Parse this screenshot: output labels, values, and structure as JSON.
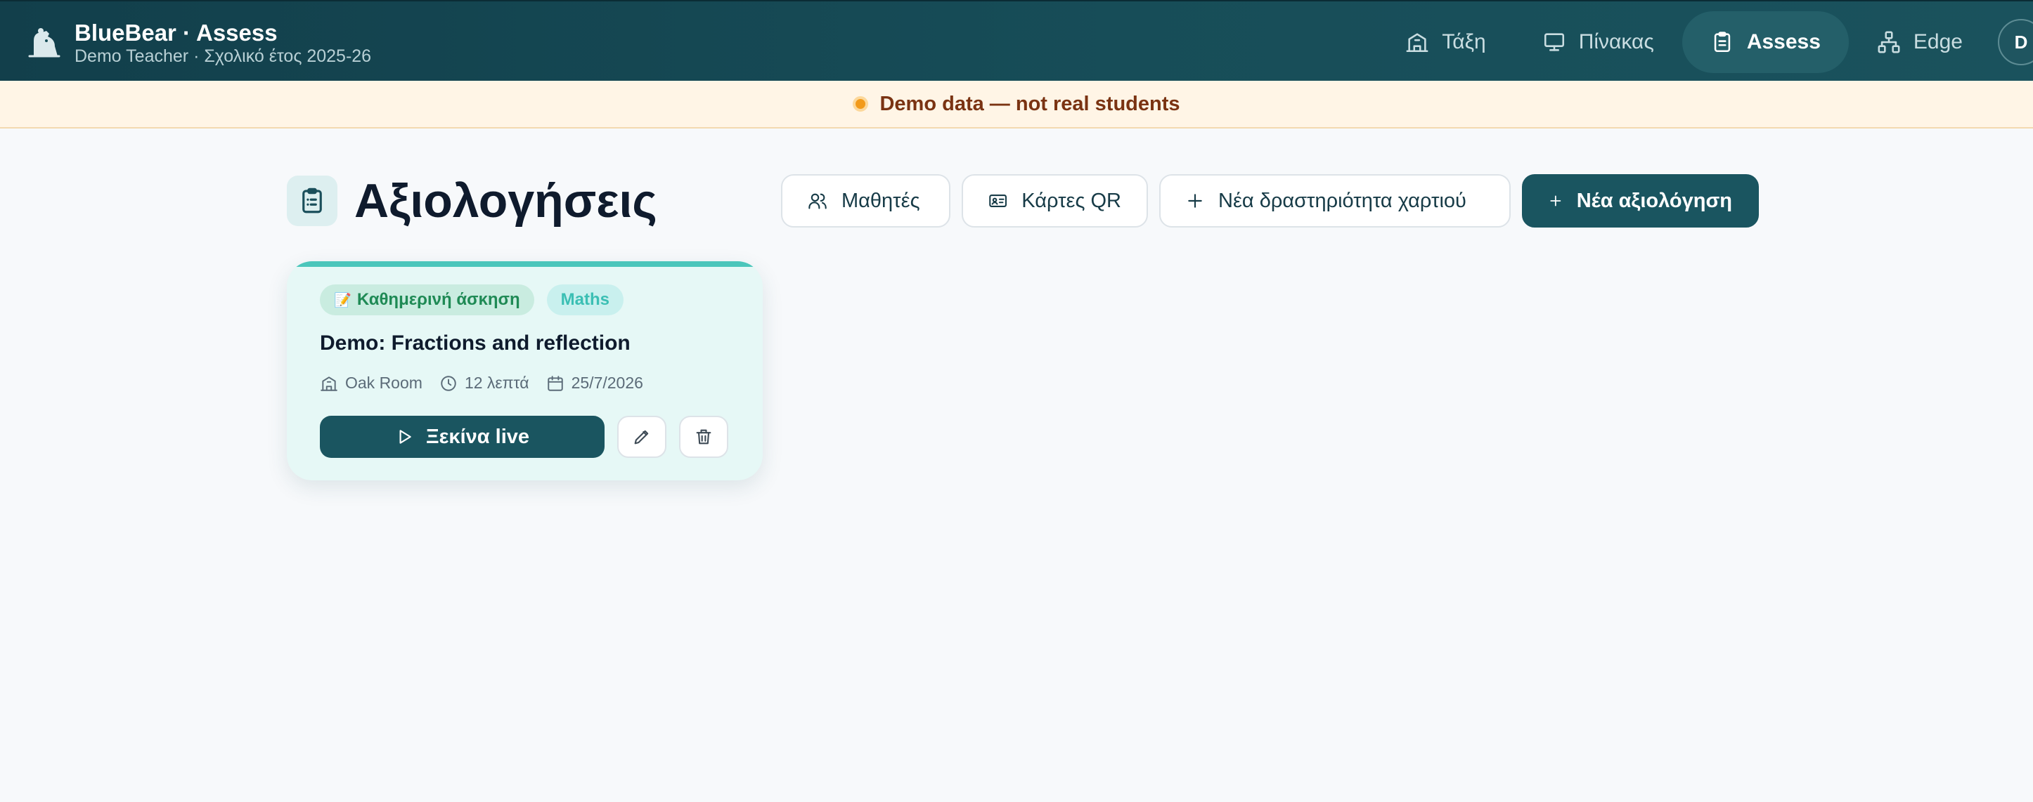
{
  "header": {
    "app_title": "BlueBear · Assess",
    "subtitle": "Demo Teacher · Σχολικό έτος 2025-26",
    "nav": [
      {
        "label": "Τάξη",
        "icon": "school-icon",
        "active": false
      },
      {
        "label": "Πίνακας",
        "icon": "presentation-board-icon",
        "active": false
      },
      {
        "label": "Assess",
        "icon": "clipboard-list-icon",
        "active": true
      },
      {
        "label": "Edge",
        "icon": "network-icon",
        "active": false
      }
    ],
    "avatar_initial": "D"
  },
  "banner": {
    "text": "Demo data — not real students",
    "dot_color": "#f29a1a"
  },
  "page": {
    "title": "Αξιολογήσεις",
    "title_icon": "clipboard-list-icon"
  },
  "actions": {
    "students_label": "Μαθητές",
    "qr_cards_label": "Κάρτες QR",
    "new_paper_activity_label": "Νέα δραστηριότητα χαρτιού",
    "new_assessment_label": "Νέα αξιολόγηση"
  },
  "assessments": [
    {
      "tag_type": "Καθημερινή άσκηση",
      "tag_type_emoji": "📝",
      "tag_subject": "Maths",
      "title": "Demo: Fractions and reflection",
      "room": "Oak Room",
      "duration": "12 λεπτά",
      "date": "25/7/2026",
      "start_label": "Ξεκίνα live",
      "edit_icon": "pencil-icon",
      "delete_icon": "trash-icon"
    }
  ],
  "colors": {
    "topbar": "#174d58",
    "accent": "#1a5560",
    "card_background": "#e6f8f6",
    "card_topline": "#4bc6bb",
    "banner_background": "#fff5e6",
    "banner_text": "#7a3312"
  }
}
